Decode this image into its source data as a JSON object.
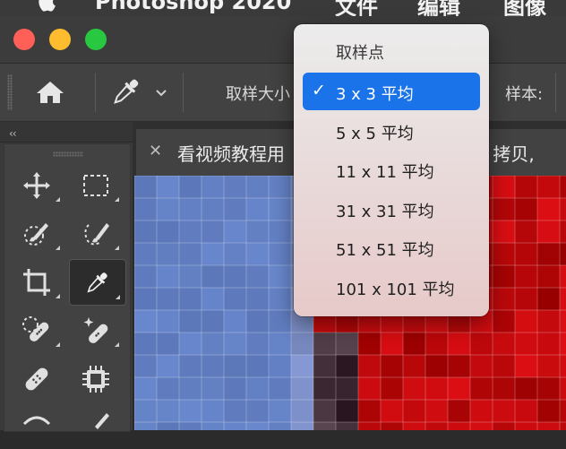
{
  "menubar": {
    "app_name": "Photoshop 2020",
    "items": [
      "文件",
      "编辑",
      "图像"
    ]
  },
  "options": {
    "sample_size_label": "取样大小",
    "sample_label": "样本:"
  },
  "document": {
    "tab_title_start": "看视频教程用",
    "tab_title_end": "叶 拷贝,"
  },
  "dropdown": {
    "header": "取样点",
    "selected_index": 0,
    "items": [
      "3 x 3 平均",
      "5 x 5 平均",
      "11 x 11 平均",
      "31 x 31 平均",
      "51 x 51 平均",
      "101 x 101 平均"
    ]
  },
  "colors": {
    "accent": "#1a73e8",
    "close": "#fe5f57",
    "minimize": "#febc2e",
    "zoom": "#28c840"
  },
  "icons": [
    "apple-icon",
    "home-icon",
    "eyedropper-icon",
    "chevron-down-icon",
    "move-icon",
    "marquee-icon",
    "quick-selection-icon",
    "select-subject-icon",
    "crop-icon",
    "spot-healing-icon",
    "content-aware-icon",
    "bandage-icon",
    "patch-icon",
    "brush-icon",
    "checkmark-icon",
    "close-icon",
    "collapse-icon"
  ]
}
